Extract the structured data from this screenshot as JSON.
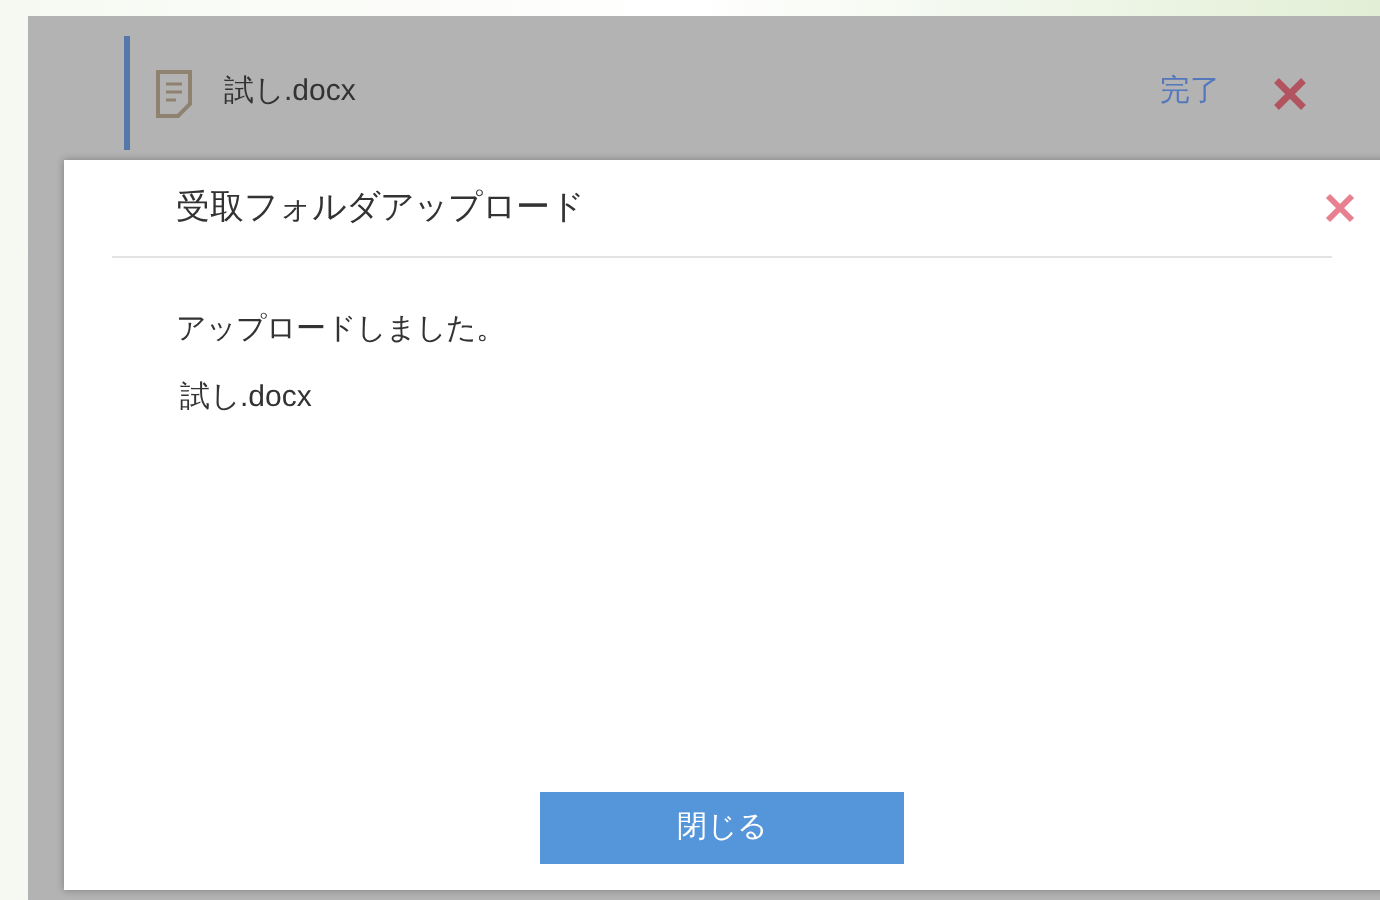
{
  "file_row": {
    "name": "試し.docx",
    "status": "完了"
  },
  "dialog": {
    "title": "受取フォルダアップロード",
    "message": "アップロードしました。",
    "file": "試し.docx",
    "button": "閉じる"
  }
}
